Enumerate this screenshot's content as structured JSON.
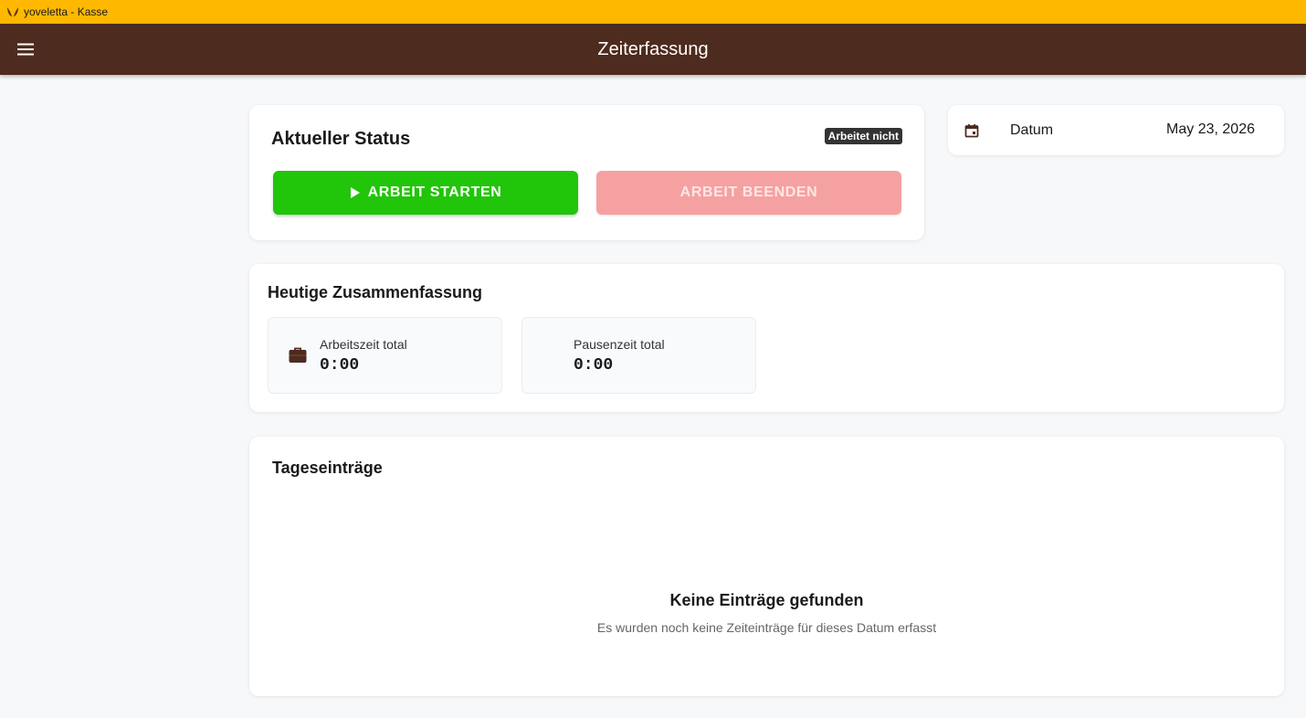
{
  "window": {
    "title": "yoveletta - Kasse",
    "logo_icon": "yoveletta-logo-icon"
  },
  "appbar": {
    "title": "Zeiterfassung",
    "menu_icon": "hamburger-menu-icon"
  },
  "status": {
    "heading": "Aktueller Status",
    "badge": "Arbeitet nicht",
    "start_label": "ARBEIT STARTEN",
    "stop_label": "ARBEIT BEENDEN"
  },
  "date": {
    "label": "Datum",
    "value": "May 23, 2026",
    "icon": "calendar-icon"
  },
  "summary": {
    "heading": "Heutige Zusammenfassung",
    "work": {
      "label": "Arbeitszeit total",
      "value": "0:00",
      "icon": "briefcase-icon"
    },
    "pause": {
      "label": "Pausenzeit total",
      "value": "0:00"
    }
  },
  "entries": {
    "heading": "Tageseinträge",
    "empty_title": "Keine Einträge gefunden",
    "empty_subtitle": "Es wurden noch keine Zeiteinträge für dieses Datum erfasst"
  },
  "colors": {
    "titlebar": "#ffb800",
    "appbar": "#4e2b1f",
    "start_button": "#21c50a",
    "stop_button_disabled": "#f5a1a1",
    "badge": "#333333"
  }
}
